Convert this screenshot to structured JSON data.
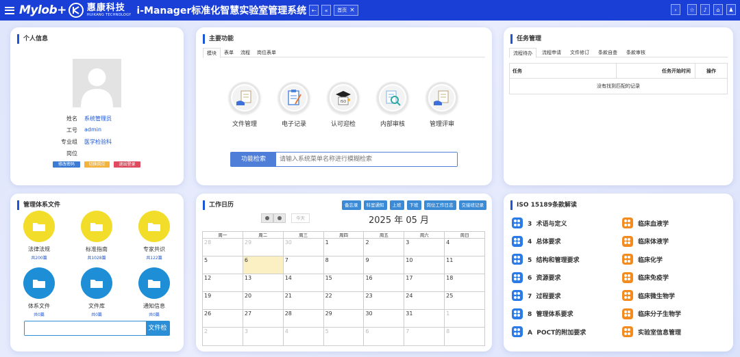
{
  "header": {
    "logo_text": "Mylob+",
    "brand_name": "惠康科技",
    "brand_sub": "HUIKANG TECHNOLOGY",
    "app_title": "i-Manager标准化智慧实验室管理系统",
    "home_tab": "首页",
    "accent_color": "#1a3fd6"
  },
  "personal": {
    "title": "个人信息",
    "fields": [
      {
        "label": "姓名",
        "value": "系统管理员"
      },
      {
        "label": "工号",
        "value": "admin"
      },
      {
        "label": "专业组",
        "value": "医学检验科"
      },
      {
        "label": "岗位",
        "value": ""
      }
    ],
    "buttons": [
      {
        "label": "修改密码",
        "color": "#3b7bd4"
      },
      {
        "label": "切换岗位",
        "color": "#f3b33d"
      },
      {
        "label": "退出登录",
        "color": "#e04a5f"
      }
    ]
  },
  "functions": {
    "title": "主要功能",
    "tabs": [
      "模块",
      "表单",
      "流程",
      "岗位表单"
    ],
    "items": [
      {
        "label": "文件管理",
        "icon": "document-hand-icon"
      },
      {
        "label": "电子记录",
        "icon": "clipboard-record-icon"
      },
      {
        "label": "认可迎检",
        "icon": "iso-certificate-icon"
      },
      {
        "label": "内部审核",
        "icon": "magnifier-audit-icon"
      },
      {
        "label": "管理评审",
        "icon": "review-hand-icon"
      }
    ],
    "search_button": "功能检索",
    "search_placeholder": "请输入系统菜单名称进行模糊检索"
  },
  "tasks": {
    "title": "任务管理",
    "tabs": [
      "流程待办",
      "流程申请",
      "文件修订",
      "条款自查",
      "条款审核"
    ],
    "columns": [
      "任务",
      "任务开始时间",
      "操作"
    ],
    "empty_text": "没有找到匹配的记录"
  },
  "docs": {
    "title": "管理体系文件",
    "items": [
      {
        "name": "法律法规",
        "count": "共200篇",
        "color": "#f2dd2a"
      },
      {
        "name": "标准指南",
        "count": "共1028篇",
        "color": "#f2dd2a"
      },
      {
        "name": "专家共识",
        "count": "共122篇",
        "color": "#f2dd2a"
      },
      {
        "name": "体系文件",
        "count": "共0篇",
        "color": "#1e8fd6"
      },
      {
        "name": "文件库",
        "count": "共0篇",
        "color": "#1e8fd6"
      },
      {
        "name": "通知信息",
        "count": "共0篇",
        "color": "#1e8fd6"
      }
    ],
    "search_button": "文件检索"
  },
  "calendar": {
    "title": "工作日历",
    "buttons": [
      "备忘录",
      "科室通知",
      "上班",
      "下班",
      "岗位工作日志",
      "交接班记录"
    ],
    "today_label": "今天",
    "month_title": "2025 年 05 月",
    "weekdays": [
      "周一",
      "周二",
      "周三",
      "周四",
      "周五",
      "周六",
      "周日"
    ],
    "weeks": [
      [
        "28",
        "29",
        "30",
        "1",
        "2",
        "3",
        "4"
      ],
      [
        "5",
        "6",
        "7",
        "8",
        "9",
        "10",
        "11"
      ],
      [
        "12",
        "13",
        "14",
        "15",
        "16",
        "17",
        "18"
      ],
      [
        "19",
        "20",
        "21",
        "22",
        "23",
        "24",
        "25"
      ],
      [
        "26",
        "27",
        "28",
        "29",
        "30",
        "31",
        "1"
      ],
      [
        "2",
        "3",
        "4",
        "5",
        "6",
        "7",
        "8"
      ]
    ]
  },
  "iso": {
    "title": "ISO 15189条款解读",
    "left": [
      "3  术语与定义",
      "4  总体要求",
      "5  结构和管理要求",
      "6  资源要求",
      "7  过程要求",
      "8  管理体系要求",
      "A  POCT的附加要求"
    ],
    "right": [
      "临床血液学",
      "临床体液学",
      "临床化学",
      "临床免疫学",
      "临床微生物学",
      "临床分子生物学",
      "实验室信息管理"
    ],
    "left_color": "#2a7be8",
    "right_color": "#f38b1f"
  }
}
